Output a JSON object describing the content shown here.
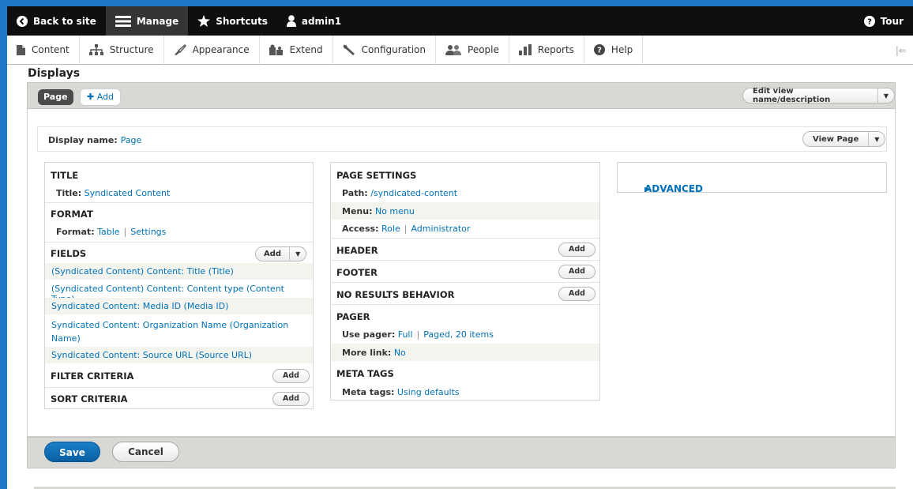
{
  "toolbar": {
    "back_label": "Back to site",
    "manage_label": "Manage",
    "shortcuts_label": "Shortcuts",
    "user_label": "admin1",
    "tour_label": "Tour"
  },
  "tray": {
    "items": [
      {
        "label": "Content",
        "icon": "file-icon"
      },
      {
        "label": "Structure",
        "icon": "hierarchy-icon"
      },
      {
        "label": "Appearance",
        "icon": "brush-icon"
      },
      {
        "label": "Extend",
        "icon": "puzzle-icon"
      },
      {
        "label": "Configuration",
        "icon": "wrench-icon"
      },
      {
        "label": "People",
        "icon": "people-icon"
      },
      {
        "label": "Reports",
        "icon": "bar-chart-icon"
      },
      {
        "label": "Help",
        "icon": "question-icon"
      }
    ]
  },
  "displays": {
    "title": "Displays",
    "tab_page": "Page",
    "tab_add": "Add",
    "edit_view_btn": "Edit view name/description",
    "display_name_label": "Display name:",
    "display_name_value": "Page",
    "view_page_btn": "View Page"
  },
  "left": {
    "title_section": "TITLE",
    "title_key": "Title:",
    "title_value": "Syndicated Content",
    "format_section": "FORMAT",
    "format_key": "Format:",
    "format_value": "Table",
    "format_settings": "Settings",
    "fields_section": "FIELDS",
    "fields_add": "Add",
    "fields": [
      "(Syndicated Content) Content: Title (Title)",
      "(Syndicated Content) Content: Content type (Content Type)",
      "Syndicated Content: Media ID (Media ID)",
      "Syndicated Content: Organization Name (Organization",
      "Name)",
      "Syndicated Content: Source URL (Source URL)"
    ],
    "filter_section": "FILTER CRITERIA",
    "filter_add": "Add",
    "sort_section": "SORT CRITERIA",
    "sort_add": "Add"
  },
  "middle": {
    "page_settings": "PAGE SETTINGS",
    "path_key": "Path:",
    "path_value": "/syndicated-content",
    "menu_key": "Menu:",
    "menu_value": "No menu",
    "access_key": "Access:",
    "access_value": "Role",
    "access_value2": "Administrator",
    "header_section": "HEADER",
    "header_add": "Add",
    "footer_section": "FOOTER",
    "footer_add": "Add",
    "noresults_section": "NO RESULTS BEHAVIOR",
    "noresults_add": "Add",
    "pager_section": "PAGER",
    "pager_key": "Use pager:",
    "pager_value": "Full",
    "pager_value2": "Paged, 20 items",
    "morelink_key": "More link:",
    "morelink_value": "No",
    "metatags_section": "META TAGS",
    "metatags_key": "Meta tags:",
    "metatags_value": "Using defaults"
  },
  "right": {
    "advanced_label": "ADVANCED"
  },
  "actions": {
    "save": "Save",
    "cancel": "Cancel"
  },
  "colors": {
    "link": "#0071b8",
    "primary": "#0a5fa3",
    "toolbar_bg": "#0f0f0f"
  }
}
